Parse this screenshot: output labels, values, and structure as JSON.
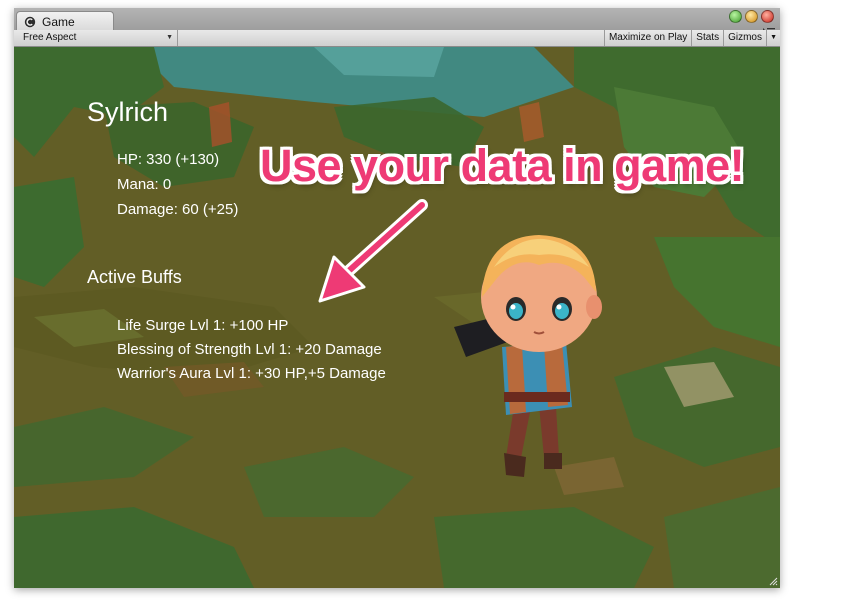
{
  "window": {
    "tab_title": "Game",
    "icons": {
      "tab": "unity-logo-icon",
      "menu": "menu-icon",
      "grip": "resize-grip-icon"
    },
    "controls": [
      "minimize-green",
      "zoom-yellow",
      "close-red"
    ]
  },
  "toolbar": {
    "aspect_label": "Free Aspect",
    "maximize_label": "Maximize on Play",
    "stats_label": "Stats",
    "gizmos_label": "Gizmos"
  },
  "game": {
    "character_name": "Sylrich",
    "stats": [
      {
        "label": "HP: 330 (+130)"
      },
      {
        "label": "Mana: 0"
      },
      {
        "label": "Damage: 60 (+25)"
      }
    ],
    "buffs_title": "Active Buffs",
    "buffs": [
      {
        "label": "Life Surge Lvl 1: +100 HP"
      },
      {
        "label": "Blessing of Strength Lvl 1: +20 Damage"
      },
      {
        "label": "Warrior's Aura Lvl 1: +30 HP,+5 Damage"
      }
    ],
    "promo_text": "Use your data in game!"
  },
  "colors": {
    "promo": "#ee3a75",
    "ground": "#625e26",
    "foliage": "#3e6a2e",
    "sky": "#3c8c8a"
  }
}
